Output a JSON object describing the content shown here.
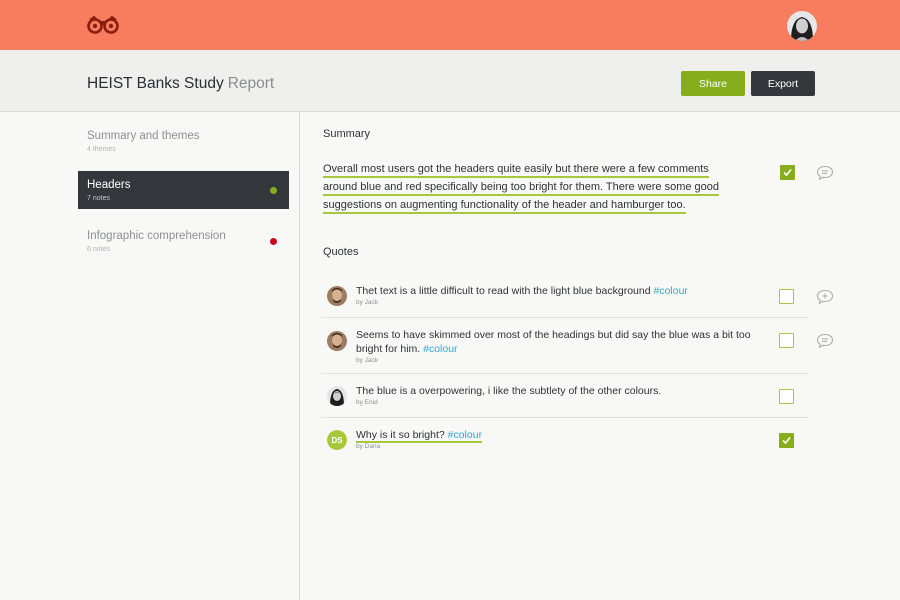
{
  "app": {
    "logo_icon": "binoculars-icon",
    "profile_avatar": "user-avatar"
  },
  "header": {
    "title": "HEIST Banks Study",
    "title_suffix": "Report",
    "share_label": "Share",
    "export_label": "Export"
  },
  "sidebar": {
    "items": [
      {
        "label": "Summary and themes",
        "count": "4 themes",
        "active": false,
        "dot_color": ""
      },
      {
        "label": "Headers",
        "count": "7 notes",
        "active": true,
        "dot_color": "#85ad1c"
      },
      {
        "label": "Infographic comprehension",
        "count": "6 notes",
        "active": false,
        "dot_color": "#d0021b"
      }
    ]
  },
  "summary": {
    "heading": "Summary",
    "lines": [
      "Overall most users got the headers quite easily but there were a few comments",
      "around blue and red specifically being  too bright for them. There were some good",
      "suggestions on augmenting functionality of the header and hamburger too."
    ],
    "checked": true
  },
  "quotes": {
    "heading": "Quotes",
    "items": [
      {
        "text": "Thet text is a little difficult to read with the light blue background ",
        "tag": "#colour",
        "author": "by Jack",
        "checked": false,
        "has_comment": true
      },
      {
        "text": "Seems to have skimmed over most of the headings but did say the blue was a bit too bright for him. ",
        "tag": "#colour",
        "author": "by Jack",
        "checked": false,
        "has_comment": true
      },
      {
        "text": "The blue is a overpowering, i like the subtlety of the other colours.",
        "tag": "",
        "author": "by Enid",
        "checked": false,
        "has_comment": false
      },
      {
        "text": "Why is it so bright? ",
        "tag": "#colour",
        "author": "by Daria",
        "checked": true,
        "has_comment": false,
        "initials": "DS"
      }
    ]
  },
  "colors": {
    "topbar": "#f87d5e",
    "accent_green": "#85ad1c",
    "dark": "#33373c",
    "tag_blue": "#2ea9d6"
  }
}
